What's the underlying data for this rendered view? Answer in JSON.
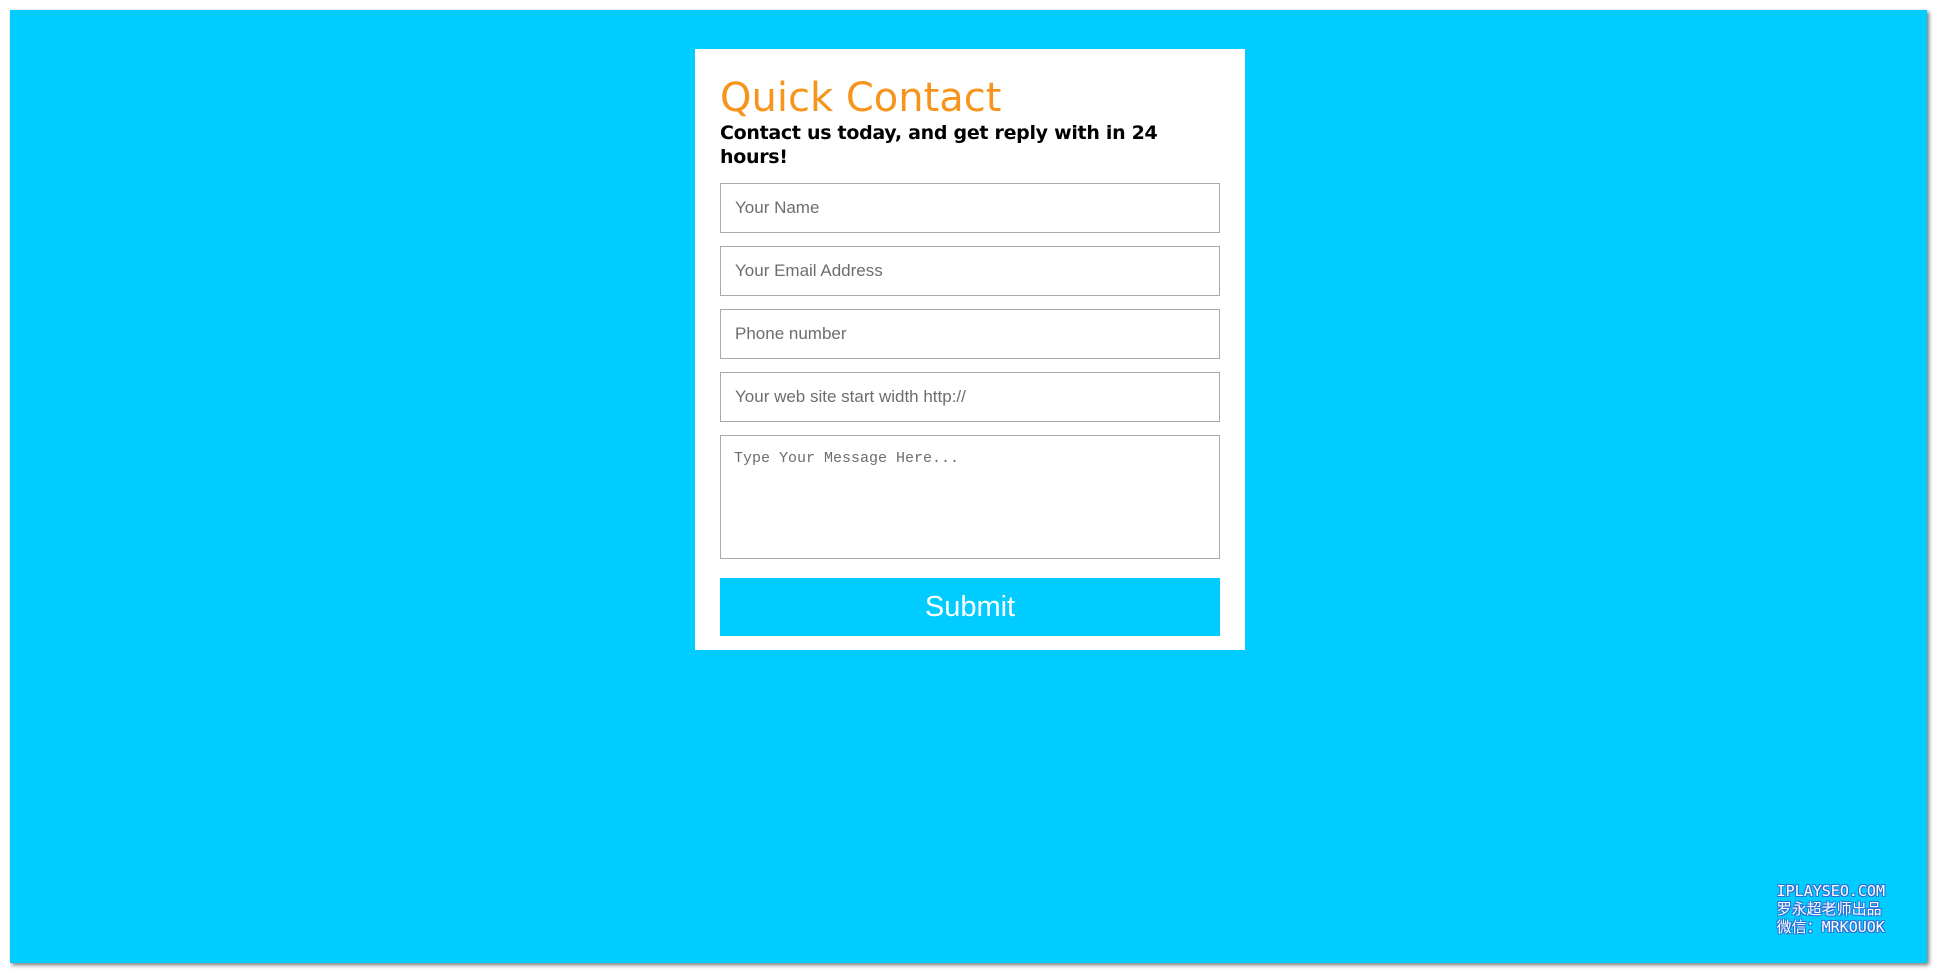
{
  "page": {
    "background_color": "#00ccff",
    "accent_color": "#f7941d"
  },
  "form": {
    "title": "Quick Contact",
    "subtitle": "Contact us today, and get reply with in 24 hours!",
    "fields": {
      "name_placeholder": "Your Name",
      "email_placeholder": "Your Email Address",
      "phone_placeholder": "Phone number",
      "website_placeholder": "Your web site start width http://",
      "message_placeholder": "Type Your Message Here..."
    },
    "submit_label": "Submit"
  },
  "watermark": {
    "line1": "IPLAYSEO.COM",
    "line2": "罗永超老师出品",
    "line3": "微信：MRKOUOK"
  }
}
